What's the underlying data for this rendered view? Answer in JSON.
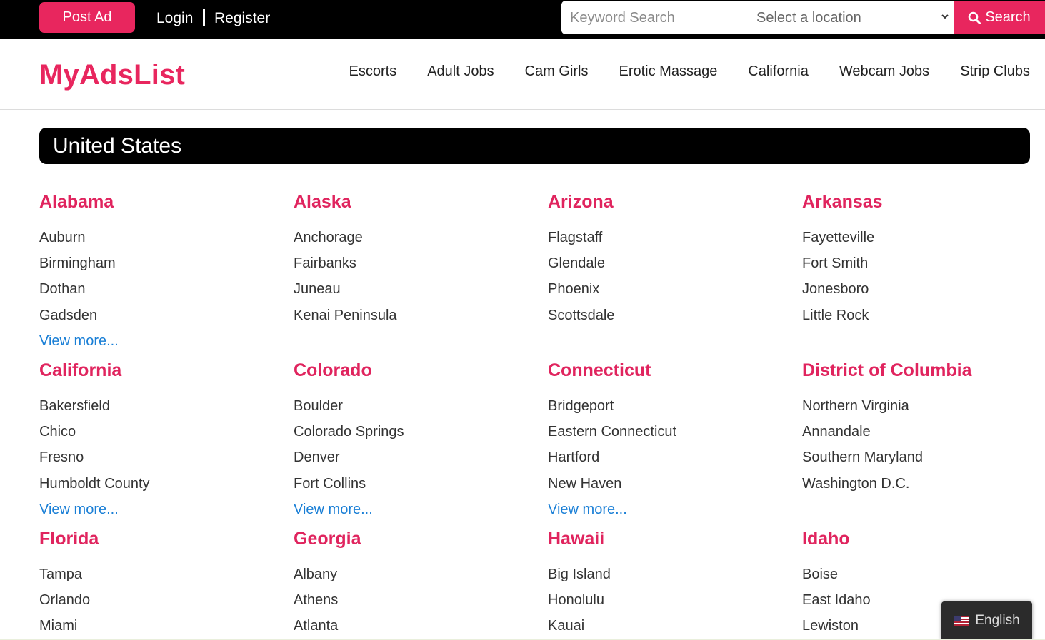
{
  "topbar": {
    "post_ad": "Post Ad",
    "login": "Login",
    "register": "Register",
    "keyword_placeholder": "Keyword Search",
    "location_selected": "Select a location",
    "search_label": "Search"
  },
  "header": {
    "logo": "MyAdsList",
    "nav": [
      "Escorts",
      "Adult Jobs",
      "Cam Girls",
      "Erotic Massage",
      "California",
      "Webcam Jobs",
      "Strip Clubs"
    ]
  },
  "country": "United States",
  "states": [
    {
      "name": "Alabama",
      "cities": [
        "Auburn",
        "Birmingham",
        "Dothan",
        "Gadsden"
      ],
      "view_more": "View more..."
    },
    {
      "name": "Alaska",
      "cities": [
        "Anchorage",
        "Fairbanks",
        "Juneau",
        "Kenai Peninsula"
      ],
      "view_more": null
    },
    {
      "name": "Arizona",
      "cities": [
        "Flagstaff",
        "Glendale",
        "Phoenix",
        "Scottsdale"
      ],
      "view_more": null
    },
    {
      "name": "Arkansas",
      "cities": [
        "Fayetteville",
        "Fort Smith",
        "Jonesboro",
        "Little Rock"
      ],
      "view_more": null
    },
    {
      "name": "California",
      "cities": [
        "Bakersfield",
        "Chico",
        "Fresno",
        "Humboldt County"
      ],
      "view_more": "View more..."
    },
    {
      "name": "Colorado",
      "cities": [
        "Boulder",
        "Colorado Springs",
        "Denver",
        "Fort Collins"
      ],
      "view_more": "View more..."
    },
    {
      "name": "Connecticut",
      "cities": [
        "Bridgeport",
        "Eastern Connecticut",
        "Hartford",
        "New Haven"
      ],
      "view_more": "View more..."
    },
    {
      "name": "District of Columbia",
      "cities": [
        "Northern Virginia",
        "Annandale",
        "Southern Maryland",
        "Washington D.C."
      ],
      "view_more": null
    },
    {
      "name": "Florida",
      "cities": [
        "Tampa",
        "Orlando",
        "Miami"
      ],
      "view_more": null
    },
    {
      "name": "Georgia",
      "cities": [
        "Albany",
        "Athens",
        "Atlanta"
      ],
      "view_more": null
    },
    {
      "name": "Hawaii",
      "cities": [
        "Big Island",
        "Honolulu",
        "Kauai"
      ],
      "view_more": null
    },
    {
      "name": "Idaho",
      "cities": [
        "Boise",
        "East Idaho",
        "Lewiston"
      ],
      "view_more": null
    }
  ],
  "language": {
    "label": "English",
    "flag": "us-flag-icon"
  },
  "colors": {
    "accent": "#e8265e",
    "state_title": "#e0245e",
    "link": "#1a7fd6",
    "topbar_bg": "#000000"
  }
}
